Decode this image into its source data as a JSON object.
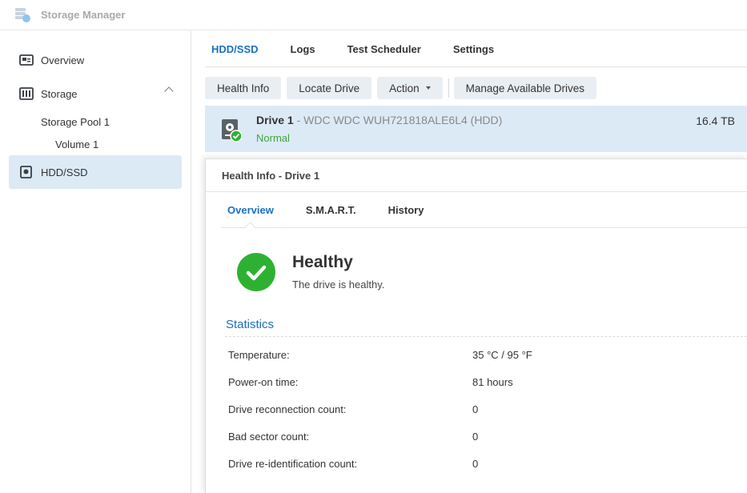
{
  "app": {
    "title": "Storage Manager",
    "icon": "storage-manager-icon"
  },
  "sidebar": {
    "items": [
      {
        "label": "Overview",
        "icon": "overview-icon"
      },
      {
        "label": "Storage",
        "icon": "storage-icon"
      },
      {
        "label": "HDD/SSD",
        "icon": "hdd-icon"
      }
    ],
    "sub_items": [
      {
        "label": "Storage Pool 1"
      },
      {
        "label": "Volume 1"
      }
    ]
  },
  "main": {
    "tabs": [
      {
        "label": "HDD/SSD"
      },
      {
        "label": "Logs"
      },
      {
        "label": "Test Scheduler"
      },
      {
        "label": "Settings"
      }
    ],
    "toolbar": {
      "health_info": "Health Info",
      "locate_drive": "Locate Drive",
      "action": "Action",
      "manage_drives": "Manage Available Drives"
    },
    "drive": {
      "name": "Drive 1",
      "model": " - WDC WDC WUH721818ALE6L4 (HDD)",
      "status": "Normal",
      "size": "16.4 TB"
    }
  },
  "dialog": {
    "title": "Health Info - Drive 1",
    "tabs": [
      {
        "label": "Overview"
      },
      {
        "label": "S.M.A.R.T."
      },
      {
        "label": "History"
      }
    ],
    "health": {
      "title": "Healthy",
      "description": "The drive is healthy."
    },
    "statistics": {
      "title": "Statistics",
      "rows": [
        {
          "label": "Temperature:",
          "value": "35 °C / 95 °F"
        },
        {
          "label": "Power-on time:",
          "value": "81 hours"
        },
        {
          "label": "Drive reconnection count:",
          "value": "0"
        },
        {
          "label": "Bad sector count:",
          "value": "0"
        },
        {
          "label": "Drive re-identification count:",
          "value": "0"
        }
      ]
    }
  },
  "colors": {
    "accent": "#1b6fbf",
    "selected": "#dceaf6",
    "healthy": "#2eb132",
    "status_normal": "#3fa33f"
  }
}
